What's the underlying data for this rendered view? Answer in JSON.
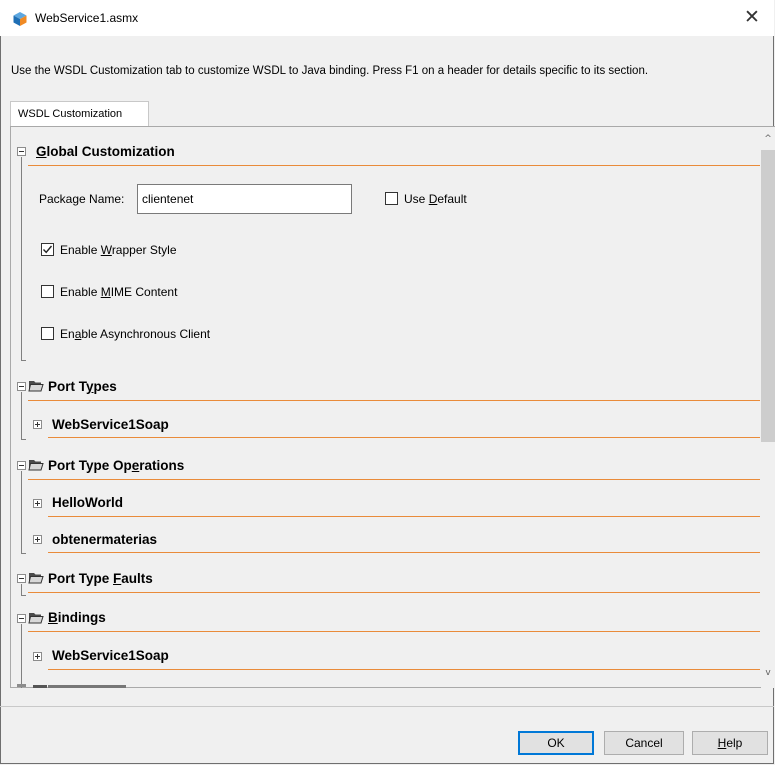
{
  "window": {
    "title": "WebService1.asmx",
    "close_glyph": "✕",
    "icon": "netbeans-cube-icon"
  },
  "description": "Use the WSDL Customization tab to customize WSDL to Java binding. Press F1 on a header for details specific to its section.",
  "tab": {
    "label": "WSDL Customization"
  },
  "global": {
    "header_mnemonic": "G",
    "header_rest": "lobal Customization",
    "package_label": "Package Name:",
    "package_value": "clientenet",
    "use_default": {
      "pre": "Use ",
      "mn": "D",
      "post": "efault",
      "checked": false
    },
    "wrapper": {
      "pre": "Enable ",
      "mn": "W",
      "post": "rapper Style",
      "checked": true
    },
    "mime": {
      "pre": "Enable ",
      "mn": "M",
      "post": "IME Content",
      "checked": false
    },
    "async": {
      "pre": "En",
      "mn": "a",
      "post": "ble Asynchronous Client",
      "checked": false
    }
  },
  "port_types": {
    "pre": "Port T",
    "mn": "y",
    "post": "pes",
    "items": [
      "WebService1Soap"
    ]
  },
  "port_type_operations": {
    "pre": "Port Type Op",
    "mn": "e",
    "post": "rations",
    "items": [
      "HelloWorld",
      "obtenermaterias"
    ]
  },
  "port_type_faults": {
    "pre": "Port Type ",
    "mn": "F",
    "post": "aults"
  },
  "bindings": {
    "pre": "",
    "mn": "B",
    "post": "indings",
    "items": [
      "WebService1Soap"
    ]
  },
  "buttons": {
    "ok": "OK",
    "cancel": "Cancel",
    "help_mn": "H",
    "help_rest": "elp"
  },
  "scroll": {
    "up": "^",
    "down": "v"
  },
  "colors": {
    "accent_line": "#e98b3a",
    "default_button_border": "#0078d7"
  }
}
